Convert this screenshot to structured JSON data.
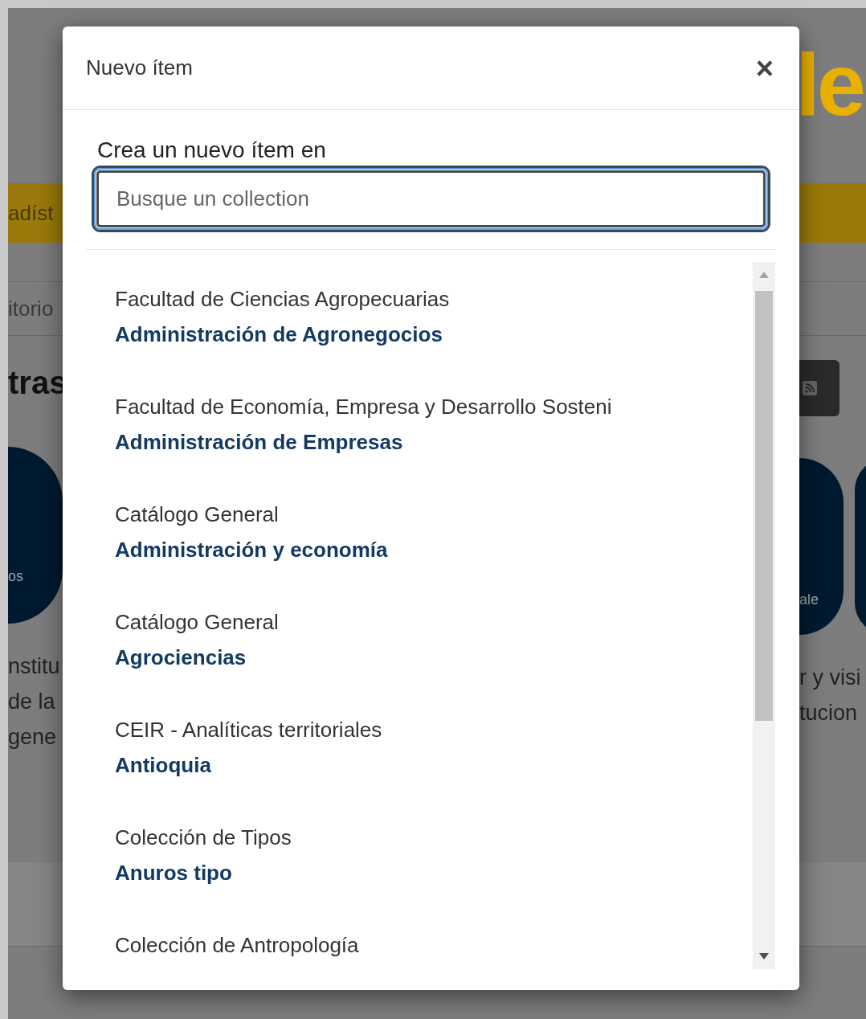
{
  "background": {
    "logo_fragment": "le",
    "nav_fragment": "adíst",
    "breadcrumb_fragment": "itorio",
    "heading_fragment": "tras",
    "left_circle_label": "os",
    "right_circle_label": "ale",
    "left_text_lines": [
      "nstitu",
      "de la",
      "gene"
    ],
    "right_text_lines": [
      "r y visi",
      "tucion"
    ]
  },
  "modal": {
    "title": "Nuevo ítem",
    "close": "×",
    "field_label": "Crea un nuevo ítem en",
    "search": {
      "placeholder": "Busque un collection"
    },
    "collections": [
      {
        "parent": "Facultad de Ciencias Agropecuarias",
        "name": "Administración de Agronegocios"
      },
      {
        "parent": "Facultad de Economía, Empresa y Desarrollo Sosteni",
        "name": "Administración de Empresas"
      },
      {
        "parent": "Catálogo General",
        "name": "Administración y economía"
      },
      {
        "parent": "Catálogo General",
        "name": "Agrociencias"
      },
      {
        "parent": "CEIR - Analíticas territoriales",
        "name": "Antioquia"
      },
      {
        "parent": "Colección de Tipos",
        "name": "Anuros tipo"
      },
      {
        "parent": "Colección de Antropología"
      }
    ]
  }
}
